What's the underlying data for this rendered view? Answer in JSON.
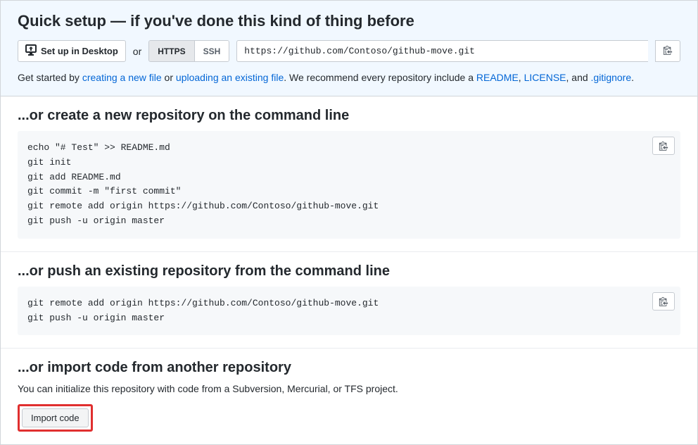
{
  "quick_setup": {
    "heading": "Quick setup — if you've done this kind of thing before",
    "desktop_button": "Set up in Desktop",
    "or": "or",
    "protocol_https": "HTTPS",
    "protocol_ssh": "SSH",
    "clone_url": "https://github.com/Contoso/github-move.git",
    "help_prefix": "Get started by ",
    "link_new_file": "creating a new file",
    "help_or": " or ",
    "link_upload": "uploading an existing file",
    "help_mid": ". We recommend every repository include a ",
    "link_readme": "README",
    "help_comma1": ", ",
    "link_license": "LICENSE",
    "help_comma2": ", and ",
    "link_gitignore": ".gitignore",
    "help_end": "."
  },
  "section_create": {
    "heading": "...or create a new repository on the command line",
    "code": "echo \"# Test\" >> README.md\ngit init\ngit add README.md\ngit commit -m \"first commit\"\ngit remote add origin https://github.com/Contoso/github-move.git\ngit push -u origin master"
  },
  "section_push": {
    "heading": "...or push an existing repository from the command line",
    "code": "git remote add origin https://github.com/Contoso/github-move.git\ngit push -u origin master"
  },
  "section_import": {
    "heading": "...or import code from another repository",
    "subtext": "You can initialize this repository with code from a Subversion, Mercurial, or TFS project.",
    "button": "Import code"
  }
}
